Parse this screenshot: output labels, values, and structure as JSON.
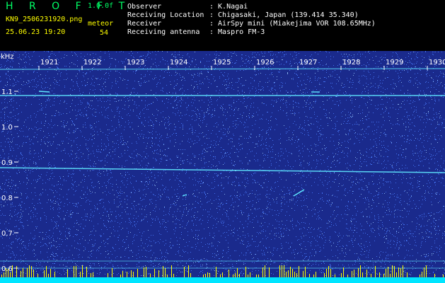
{
  "header": {
    "app_title": "H R O F F T",
    "version": "1.0.0f",
    "filename": "KN9_2506231920.png",
    "datetime": "25.06.23 19:20",
    "meteor_label": "meteor",
    "meteor_count": "54",
    "fields": [
      {
        "label": "Observer",
        "value": ": K.Nagai"
      },
      {
        "label": "Receiving Location",
        "value": ": Chigasaki, Japan (139.414 35.340)"
      },
      {
        "label": "Receiver",
        "value": ": AirSpy mini (Miakejima VOR 108.65MHz)"
      },
      {
        "label": "Receiving antenna",
        "value": ": Maspro FM-3"
      }
    ]
  },
  "spectrogram": {
    "y_unit": "kHz",
    "y_ticks": [
      "1.1",
      "1.0",
      "0.9",
      "0.8",
      "0.7",
      "0.6"
    ],
    "x_ticks": [
      "1921",
      "1922",
      "1923",
      "1924",
      "1925",
      "1926",
      "1927",
      "1928",
      "1929",
      "1930"
    ],
    "colors": {
      "background": "#1a2a8c",
      "noise": "#4a7cff",
      "signal": "#5fe8ff",
      "baseline": "#00e5ff",
      "spike": "#ffff00",
      "axis_text": "#ffffff"
    }
  }
}
